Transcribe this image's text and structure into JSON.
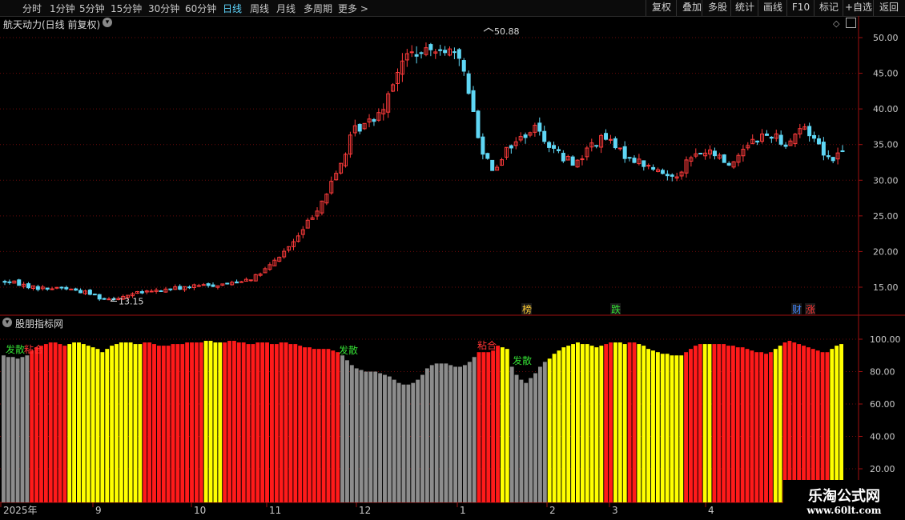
{
  "toolbar": {
    "periods": [
      "分时",
      "1分钟",
      "5分钟",
      "15分钟",
      "30分钟",
      "60分钟",
      "日线",
      "周线",
      "月线",
      "多周期",
      "更多 >"
    ],
    "active_period": "日线",
    "right_buttons": [
      "复权",
      "叠加",
      "多股",
      "统计",
      "画线",
      "F10",
      "标记",
      "+自选",
      "返回"
    ]
  },
  "main_chart": {
    "title": "航天动力(日线 前复权)",
    "high_label": "50.88",
    "low_label": "13.15",
    "y_ticks": [
      "50.00",
      "45.00",
      "40.00",
      "35.00",
      "30.00",
      "25.00",
      "20.00",
      "15.00"
    ],
    "markers": [
      {
        "text": "榜",
        "color": "#ffcc33"
      },
      {
        "text": "跌",
        "color": "#33dd33"
      },
      {
        "text": "财",
        "color": "#4488ff"
      },
      {
        "text": "涨",
        "color": "#ff3333"
      }
    ]
  },
  "sub_chart": {
    "title": "股朋指标网",
    "y_ticks": [
      "100.00",
      "80.00",
      "60.00",
      "40.00",
      "20.00"
    ],
    "annotations": [
      {
        "text": "发散",
        "color": "#33dd33"
      },
      {
        "text": "粘合",
        "color": "#ff3333"
      },
      {
        "text": "发散",
        "color": "#33dd33"
      },
      {
        "text": "粘合",
        "color": "#ff3333"
      },
      {
        "text": "发散",
        "color": "#33dd33"
      }
    ]
  },
  "x_axis": {
    "labels": [
      "2025年",
      "9",
      "10",
      "11",
      "12",
      "1",
      "2",
      "3",
      "4"
    ]
  },
  "watermark": {
    "line1": "乐淘公式网",
    "line2": "www.60lt.com"
  },
  "colors": {
    "up": "#ff3b3b",
    "down": "#5fd7f5",
    "bar_red": "#ff1a1a",
    "bar_yellow": "#ffff00",
    "bar_gray": "#8c8c8c",
    "axis": "#a01010"
  },
  "chart_data": [
    {
      "type": "candlestick",
      "title": "航天动力(日线 前复权)",
      "price_anchors": [
        15.8,
        15.5,
        15.0,
        14.8,
        15.0,
        14.6,
        14.2,
        13.4,
        13.5,
        14.0,
        14.3,
        14.5,
        14.8,
        15.0,
        15.2,
        15.3,
        15.5,
        16.0,
        16.5,
        18.0,
        20.0,
        22.0,
        25.0,
        28.0,
        32.0,
        37.0,
        38.0,
        40.0,
        45.0,
        48.0,
        47.5,
        49.0,
        48.0,
        45.0,
        35.0,
        31.5,
        34.5,
        36.0,
        37.5,
        35.0,
        33.0,
        32.5,
        35.0,
        36.0,
        34.0,
        33.0,
        32.0,
        31.0,
        30.5,
        33.0,
        34.0,
        33.5,
        32.0,
        35.0,
        36.0,
        36.5,
        35.0,
        37.5,
        36.0,
        33.0,
        34.0
      ],
      "candle_count": 178,
      "high": 50.88,
      "low": 13.15,
      "ylim": [
        12,
        52
      ]
    },
    {
      "type": "bar",
      "title": "股朋指标网",
      "ylim": [
        0,
        110
      ],
      "segments": [
        {
          "n": 6,
          "color": "gray",
          "values": [
            90,
            89,
            89,
            88,
            89,
            90
          ]
        },
        {
          "n": 8,
          "color": "red",
          "values": [
            93,
            95,
            96,
            97,
            98,
            98,
            97,
            96
          ]
        },
        {
          "n": 16,
          "color": "yellow",
          "values": [
            97,
            98,
            98,
            97,
            96,
            95,
            94,
            92,
            94,
            96,
            97,
            98,
            98,
            98,
            97,
            97
          ]
        },
        {
          "n": 13,
          "color": "red",
          "values": [
            98,
            98,
            97,
            96,
            96,
            96,
            97,
            97,
            97,
            98,
            98,
            98,
            98
          ]
        },
        {
          "n": 4,
          "color": "yellow",
          "values": [
            99,
            99,
            98,
            98
          ]
        },
        {
          "n": 25,
          "color": "red",
          "values": [
            98,
            99,
            99,
            98,
            98,
            97,
            97,
            98,
            98,
            98,
            97,
            97,
            98,
            98,
            97,
            97,
            96,
            95,
            95,
            94,
            94,
            94,
            94,
            93,
            92
          ]
        },
        {
          "n": 29,
          "color": "gray",
          "values": [
            90,
            87,
            84,
            82,
            81,
            80,
            80,
            80,
            79,
            78,
            77,
            75,
            73,
            72,
            72,
            73,
            75,
            78,
            82,
            84,
            85,
            85,
            85,
            84,
            83,
            83,
            84,
            86,
            89
          ]
        },
        {
          "n": 5,
          "color": "red",
          "values": [
            92,
            92,
            92,
            93,
            96
          ]
        },
        {
          "n": 2,
          "color": "yellow",
          "values": [
            95,
            94
          ]
        },
        {
          "n": 8,
          "color": "gray",
          "values": [
            83,
            78,
            75,
            73,
            76,
            79,
            83,
            86
          ]
        },
        {
          "n": 12,
          "color": "yellow",
          "values": [
            88,
            91,
            93,
            95,
            96,
            97,
            98,
            97,
            97,
            96,
            95,
            96
          ]
        },
        {
          "n": 2,
          "color": "red",
          "values": [
            97,
            98
          ]
        },
        {
          "n": 3,
          "color": "yellow",
          "values": [
            98,
            98,
            97
          ]
        },
        {
          "n": 2,
          "color": "red",
          "values": [
            98,
            98
          ]
        },
        {
          "n": 10,
          "color": "yellow",
          "values": [
            97,
            96,
            94,
            93,
            92,
            91,
            91,
            90,
            90,
            90
          ]
        },
        {
          "n": 4,
          "color": "red",
          "values": [
            92,
            94,
            96,
            97
          ]
        },
        {
          "n": 2,
          "color": "yellow",
          "values": [
            97,
            97
          ]
        },
        {
          "n": 13,
          "color": "red",
          "values": [
            97,
            97,
            97,
            96,
            96,
            95,
            95,
            94,
            93,
            92,
            92,
            91,
            92
          ]
        },
        {
          "n": 2,
          "color": "yellow",
          "values": [
            94,
            96
          ]
        },
        {
          "n": 10,
          "color": "red",
          "values": [
            98,
            99,
            98,
            97,
            96,
            95,
            94,
            93,
            92,
            92
          ]
        },
        {
          "n": 3,
          "color": "yellow",
          "values": [
            94,
            96,
            97
          ]
        }
      ]
    }
  ]
}
